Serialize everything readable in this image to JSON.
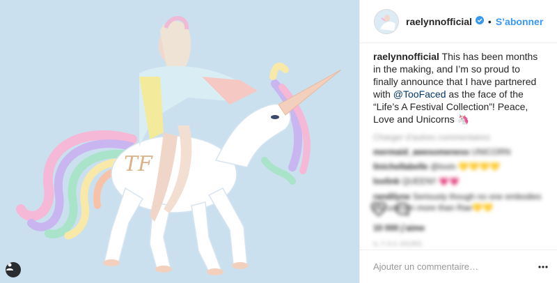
{
  "colors": {
    "media_bg": "#cbe0ef",
    "link": "#3897f0",
    "verified": "#3897f0"
  },
  "header": {
    "username": "raelynnofficial",
    "separator": "•",
    "follow_label": "S’abonner"
  },
  "caption": {
    "username": "raelynnofficial",
    "text_1": " This has been months in the making, and I’m so proud to finally announce that I have partnered with ",
    "mention": "@TooFaced",
    "text_2": " as the face of the “Life’s A Festival Collection”! Peace, Love and Unicorns 🦄"
  },
  "comments": {
    "load_more": "Charger d’autres commentaires",
    "items": [
      {
        "user": "mermaid_awesomeness",
        "text": " UNICORN"
      },
      {
        "user": "linichellabelle",
        "text": " @lovin 💛💛💛💛"
      },
      {
        "user": "lovlink",
        "text": " QUEEN!! 💗💗"
      },
      {
        "user": "randilyne",
        "text": " Seriously though no one embodies the unicorn more than Rae💛💛"
      }
    ]
  },
  "actions": {
    "like_icon": "heart-icon",
    "comment_icon": "comment-icon"
  },
  "likes": "10 000 j’aime",
  "timestamp": "IL Y A 6 JOURS",
  "add_comment": {
    "placeholder": "Ajouter un commentaire…"
  },
  "image": {
    "monogram": "TF"
  }
}
